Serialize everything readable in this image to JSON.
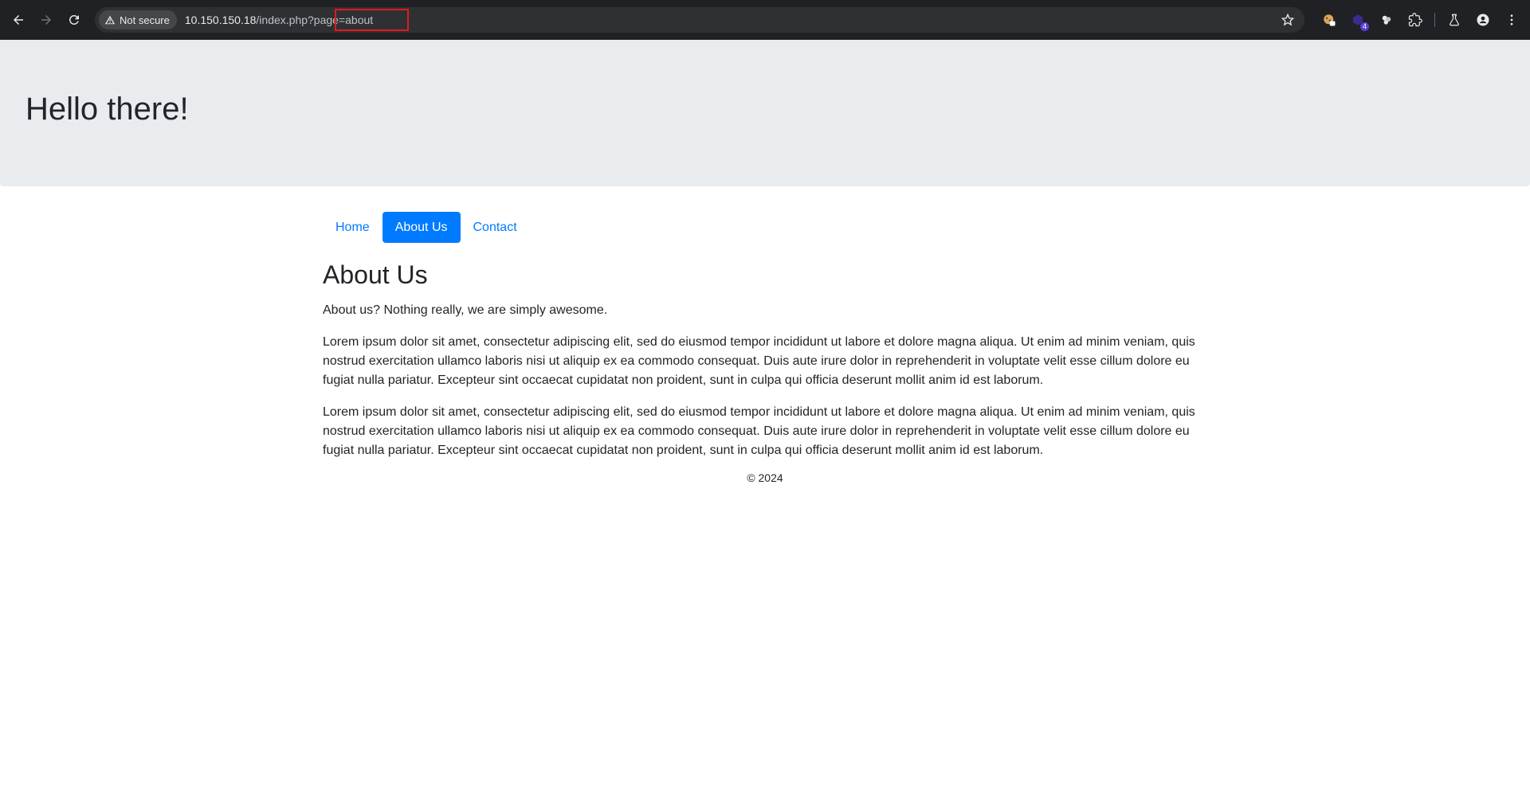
{
  "browser": {
    "security_label": "Not secure",
    "url_host": "10.150.150.18",
    "url_path": "/index.php?page=about",
    "extension_badge": "4"
  },
  "page": {
    "jumbotron_title": "Hello there!",
    "nav": [
      {
        "label": "Home",
        "active": false
      },
      {
        "label": "About Us",
        "active": true
      },
      {
        "label": "Contact",
        "active": false
      }
    ],
    "heading": "About Us",
    "intro": "About us? Nothing really, we are simply awesome.",
    "paragraphs": [
      "Lorem ipsum dolor sit amet, consectetur adipiscing elit, sed do eiusmod tempor incididunt ut labore et dolore magna aliqua. Ut enim ad minim veniam, quis nostrud exercitation ullamco laboris nisi ut aliquip ex ea commodo consequat. Duis aute irure dolor in reprehenderit in voluptate velit esse cillum dolore eu fugiat nulla pariatur. Excepteur sint occaecat cupidatat non proident, sunt in culpa qui officia deserunt mollit anim id est laborum.",
      "Lorem ipsum dolor sit amet, consectetur adipiscing elit, sed do eiusmod tempor incididunt ut labore et dolore magna aliqua. Ut enim ad minim veniam, quis nostrud exercitation ullamco laboris nisi ut aliquip ex ea commodo consequat. Duis aute irure dolor in reprehenderit in voluptate velit esse cillum dolore eu fugiat nulla pariatur. Excepteur sint occaecat cupidatat non proident, sunt in culpa qui officia deserunt mollit anim id est laborum."
    ],
    "footer": "© 2024"
  },
  "colors": {
    "primary": "#007bff",
    "jumbotron_bg": "#e9ecef",
    "annotation_box": "#e11b1b"
  }
}
